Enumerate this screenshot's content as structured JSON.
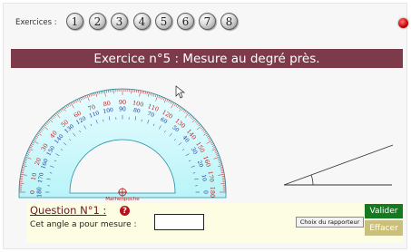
{
  "header": {
    "exercices_label": "Exercices :",
    "exercise_buttons": [
      "1",
      "2",
      "3",
      "4",
      "5",
      "6",
      "7",
      "8"
    ]
  },
  "title": "Exercice n°5 : Mesure au degré près.",
  "protractor": {
    "outer_labels": [
      "0",
      "10",
      "20",
      "30",
      "40",
      "50",
      "60",
      "70",
      "80",
      "90",
      "100",
      "110",
      "120",
      "130",
      "140",
      "150",
      "160",
      "170",
      "180"
    ],
    "inner_labels": [
      "180",
      "170",
      "160",
      "150",
      "140",
      "130",
      "120",
      "110",
      "100",
      "90",
      "80",
      "70",
      "60",
      "50",
      "40",
      "30",
      "20",
      "10",
      "0"
    ],
    "brand": "Mathenpoche"
  },
  "question": {
    "title": "Question N°1 :",
    "prompt": "Cet angle a pour mesure :",
    "answer_value": ""
  },
  "buttons": {
    "choose_protractor": "Choix du rapporteur",
    "validate": "Valider",
    "erase": "Effacer"
  },
  "colors": {
    "title_band": "#7d3a4a",
    "protractor_fill": "#b9f4f8",
    "outer_scale": "#c31b1b",
    "inner_scale": "#1a2fa8",
    "validate": "#157a1f",
    "erase": "#cbc07a"
  }
}
